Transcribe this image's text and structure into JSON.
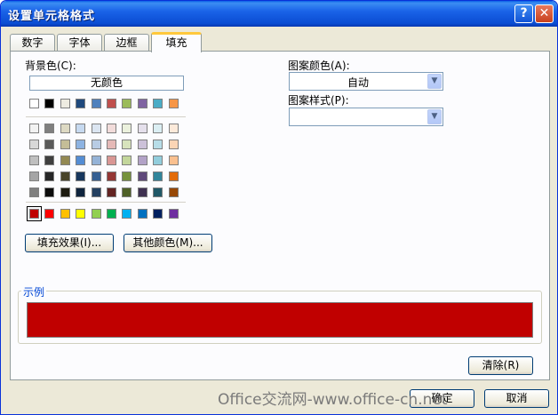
{
  "window": {
    "title": "设置单元格格式"
  },
  "titlebar_buttons": {
    "help": "?",
    "close": "✕"
  },
  "tabs": [
    {
      "label": "数字",
      "active": false
    },
    {
      "label": "字体",
      "active": false
    },
    {
      "label": "边框",
      "active": false
    },
    {
      "label": "填充",
      "active": true
    }
  ],
  "fill": {
    "background_label": "背景色(C):",
    "no_color_label": "无颜色",
    "standard_row": [
      "#ffffff",
      "#000000",
      "#eeece1",
      "#1f497d",
      "#4f81bd",
      "#c0504d",
      "#9bbb59",
      "#8064a2",
      "#4bacc6",
      "#f79646"
    ],
    "tint_rows": [
      [
        "#f2f2f2",
        "#7f7f7f",
        "#ddd9c3",
        "#c6d9f0",
        "#dbe5f1",
        "#f2dcdb",
        "#ebf1dd",
        "#e5e0ec",
        "#dbeef3",
        "#fdeada"
      ],
      [
        "#d8d8d8",
        "#595959",
        "#c4bd97",
        "#8db3e2",
        "#b8cce4",
        "#e5b9b7",
        "#d7e3bc",
        "#ccc1d9",
        "#b7dde8",
        "#fbd5b5"
      ],
      [
        "#bfbfbf",
        "#3f3f3f",
        "#938953",
        "#548dd4",
        "#95b3d7",
        "#d99694",
        "#c3d69b",
        "#b2a2c7",
        "#92cddc",
        "#fac08f"
      ],
      [
        "#a5a5a5",
        "#262626",
        "#494429",
        "#17365d",
        "#366092",
        "#953734",
        "#76923c",
        "#5f497a",
        "#31859b",
        "#e36c09"
      ],
      [
        "#7f7f7f",
        "#0c0c0c",
        "#1d1b10",
        "#0f243e",
        "#244061",
        "#632423",
        "#4f6128",
        "#3f3151",
        "#205867",
        "#974806"
      ]
    ],
    "bright_row": [
      "#c00000",
      "#ff0000",
      "#ffc000",
      "#ffff00",
      "#92d050",
      "#00b050",
      "#00b0f0",
      "#0070c0",
      "#002060",
      "#7030a0"
    ],
    "selected_color": "#c00000",
    "pattern_color_label": "图案颜色(A):",
    "pattern_color_value": "自动",
    "pattern_style_label": "图案样式(P):",
    "pattern_style_value": "",
    "fill_effects_button": "填充效果(I)...",
    "more_colors_button": "其他颜色(M)...",
    "sample_label": "示例",
    "clear_button": "清除(R)"
  },
  "footer": {
    "ok_button": "确定",
    "cancel_button": "取消"
  },
  "watermark": "Office交流网-www.office-cn.net",
  "icons": {
    "dropdown": "chevron-down-icon",
    "help": "help-icon",
    "close": "close-icon"
  }
}
